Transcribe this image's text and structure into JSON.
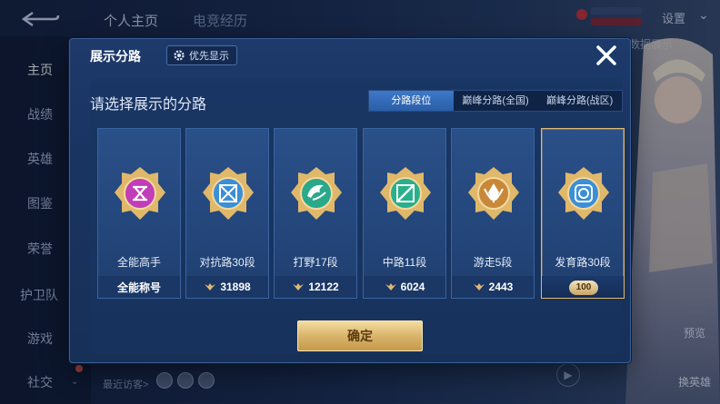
{
  "background": {
    "tabs": [
      "个人主页",
      "电竞经历"
    ],
    "settings_label": "设置",
    "data_link": "和数据展示",
    "nav_items": [
      "主页",
      "战绩",
      "英雄",
      "图鉴",
      "荣誉",
      "护卫队",
      "游戏",
      "社交"
    ],
    "recent_visitors_label": "最近访客>",
    "hero_buttons": [
      "预览",
      "换英雄"
    ]
  },
  "dialog": {
    "title": "展示分路",
    "priority_label": "优先显示",
    "subtitle": "请选择展示的分路",
    "tabs": [
      "分路段位",
      "巅峰分路(全国)",
      "巅峰分路(战区)"
    ],
    "active_tab": 0,
    "cards": [
      {
        "name": "全能高手",
        "footer": "全能称号",
        "emblem": "all-round-emblem-icon",
        "color": "#c23db8"
      },
      {
        "name": "对抗路30段",
        "footer": "31898",
        "emblem": "clash-lane-emblem-icon",
        "color": "#3a8fd6"
      },
      {
        "name": "打野17段",
        "footer": "12122",
        "emblem": "jungle-emblem-icon",
        "color": "#2aa88a"
      },
      {
        "name": "中路11段",
        "footer": "6024",
        "emblem": "mid-lane-emblem-icon",
        "color": "#28b08c"
      },
      {
        "name": "游走5段",
        "footer": "2443",
        "emblem": "roam-emblem-icon",
        "color": "#c8883a"
      },
      {
        "name": "发育路30段",
        "footer": "100",
        "emblem": "farm-lane-emblem-icon",
        "color": "#3a8fd6"
      }
    ],
    "selected_card": 5,
    "confirm_label": "确定"
  },
  "colors": {
    "accent_gold": "#e0b870",
    "dialog_bg": "#1a3462",
    "active_tab": "#3d78c8"
  }
}
